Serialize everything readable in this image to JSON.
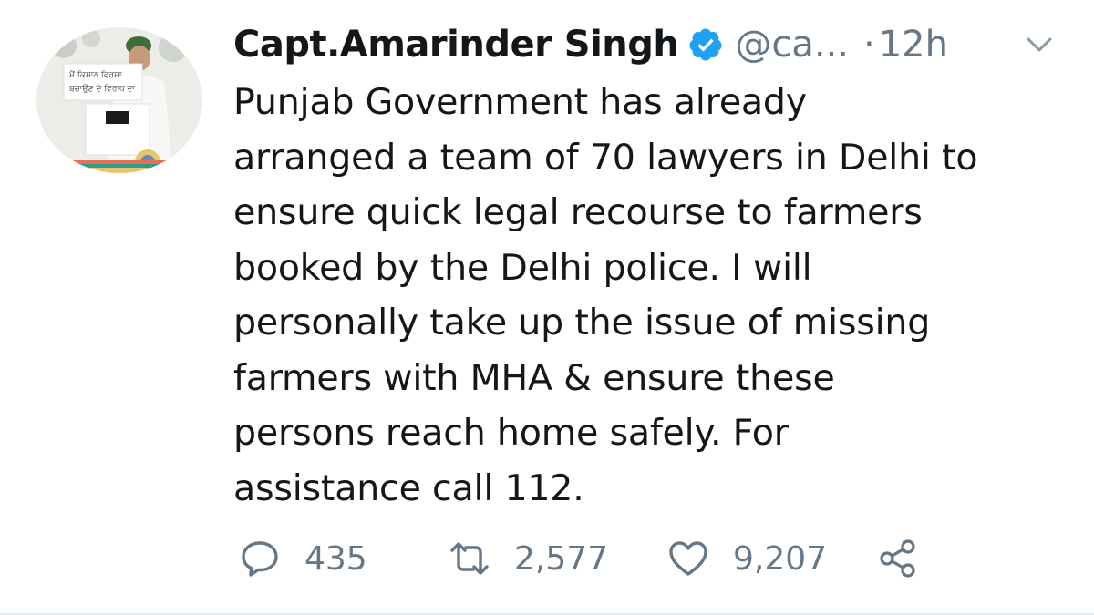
{
  "tweet": {
    "display_name": "Capt.Amarinder Singh",
    "handle": "@ca...",
    "separator": "·",
    "time": "12h",
    "body": "Punjab Government has already\narranged a team of 70 lawyers in Delhi to\nensure quick legal recourse to farmers\nbooked by the Delhi police. I will\npersonally take up the issue of missing\nfarmers with MHA & ensure these\npersons reach home safely. For\nassistance call 112.",
    "verified_icon": "verified-badge-icon",
    "avatar": {
      "sign_line1": "ਮੈਂ ਕਿਸਾਨ ਵਿਰਸਾ",
      "sign_line2": "ਬਚਾਉਣ ਦੇ ਵਿਰਾਧ ਦਾ"
    }
  },
  "actions": {
    "reply_count": "435",
    "retweet_count": "2,577",
    "like_count": "9,207"
  },
  "colors": {
    "verified_blue": "#1da1f2",
    "muted": "#657786",
    "text": "#14171a"
  }
}
